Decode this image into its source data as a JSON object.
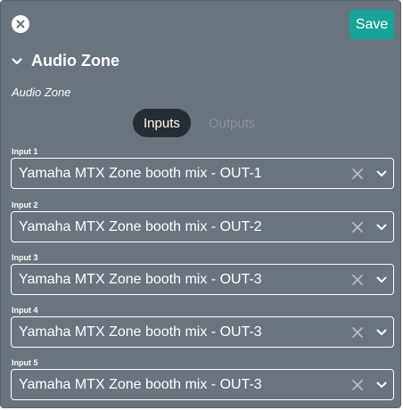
{
  "header": {
    "close_icon": "close-circle-icon",
    "save_label": "Save",
    "save_color": "#18a39a"
  },
  "section": {
    "title": "Audio Zone",
    "collapse_icon": "chevron-down-icon"
  },
  "zone": {
    "name": "Audio Zone"
  },
  "tabs": [
    {
      "label": "Inputs",
      "active": true
    },
    {
      "label": "Outputs",
      "active": false
    }
  ],
  "inputs": [
    {
      "label": "Input 1",
      "value": "Yamaha MTX Zone booth mix - OUT-1"
    },
    {
      "label": "Input 2",
      "value": "Yamaha MTX Zone booth mix - OUT-2"
    },
    {
      "label": "Input 3",
      "value": "Yamaha MTX Zone booth mix - OUT-3"
    },
    {
      "label": "Input 4",
      "value": "Yamaha MTX Zone booth mix - OUT-3"
    },
    {
      "label": "Input 5",
      "value": "Yamaha MTX Zone booth mix - OUT-3"
    }
  ]
}
